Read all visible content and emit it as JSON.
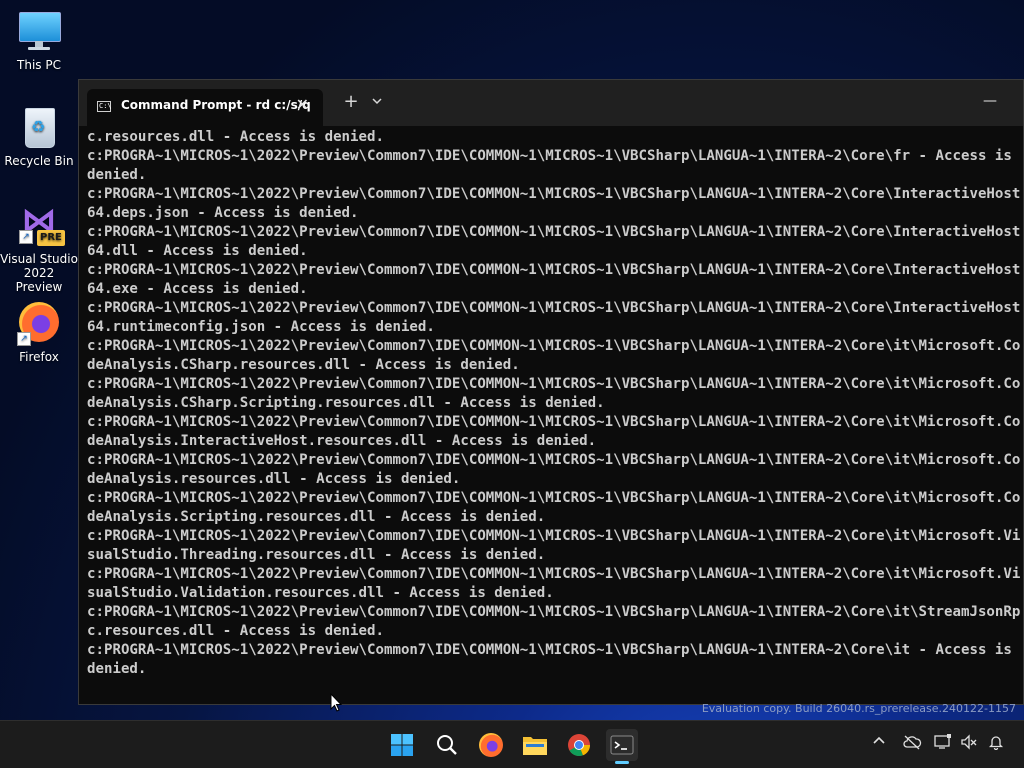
{
  "desktop": {
    "icons": [
      {
        "label": "This PC"
      },
      {
        "label": "Recycle Bin"
      },
      {
        "label_line1": "Visual Studio",
        "label_line2": "2022 Preview",
        "badge": "PRE"
      },
      {
        "label": "Firefox"
      }
    ]
  },
  "terminal": {
    "tab_title": "Command Prompt - rd  c:/s/q",
    "tab_icon_text": "C:\\",
    "close_glyph": "✕",
    "new_tab_glyph": "+",
    "minimize_glyph": "—",
    "lines": [
      "c.resources.dll - Access is denied.",
      "c:PROGRA~1\\MICROS~1\\2022\\Preview\\Common7\\IDE\\COMMON~1\\MICROS~1\\VBCSharp\\LANGUA~1\\INTERA~2\\Core\\fr - Access is",
      "denied.",
      "c:PROGRA~1\\MICROS~1\\2022\\Preview\\Common7\\IDE\\COMMON~1\\MICROS~1\\VBCSharp\\LANGUA~1\\INTERA~2\\Core\\InteractiveHost",
      "64.deps.json - Access is denied.",
      "c:PROGRA~1\\MICROS~1\\2022\\Preview\\Common7\\IDE\\COMMON~1\\MICROS~1\\VBCSharp\\LANGUA~1\\INTERA~2\\Core\\InteractiveHost",
      "64.dll - Access is denied.",
      "c:PROGRA~1\\MICROS~1\\2022\\Preview\\Common7\\IDE\\COMMON~1\\MICROS~1\\VBCSharp\\LANGUA~1\\INTERA~2\\Core\\InteractiveHost",
      "64.exe - Access is denied.",
      "c:PROGRA~1\\MICROS~1\\2022\\Preview\\Common7\\IDE\\COMMON~1\\MICROS~1\\VBCSharp\\LANGUA~1\\INTERA~2\\Core\\InteractiveHost",
      "64.runtimeconfig.json - Access is denied.",
      "c:PROGRA~1\\MICROS~1\\2022\\Preview\\Common7\\IDE\\COMMON~1\\MICROS~1\\VBCSharp\\LANGUA~1\\INTERA~2\\Core\\it\\Microsoft.Co",
      "deAnalysis.CSharp.resources.dll - Access is denied.",
      "c:PROGRA~1\\MICROS~1\\2022\\Preview\\Common7\\IDE\\COMMON~1\\MICROS~1\\VBCSharp\\LANGUA~1\\INTERA~2\\Core\\it\\Microsoft.Co",
      "deAnalysis.CSharp.Scripting.resources.dll - Access is denied.",
      "c:PROGRA~1\\MICROS~1\\2022\\Preview\\Common7\\IDE\\COMMON~1\\MICROS~1\\VBCSharp\\LANGUA~1\\INTERA~2\\Core\\it\\Microsoft.Co",
      "deAnalysis.InteractiveHost.resources.dll - Access is denied.",
      "c:PROGRA~1\\MICROS~1\\2022\\Preview\\Common7\\IDE\\COMMON~1\\MICROS~1\\VBCSharp\\LANGUA~1\\INTERA~2\\Core\\it\\Microsoft.Co",
      "deAnalysis.resources.dll - Access is denied.",
      "c:PROGRA~1\\MICROS~1\\2022\\Preview\\Common7\\IDE\\COMMON~1\\MICROS~1\\VBCSharp\\LANGUA~1\\INTERA~2\\Core\\it\\Microsoft.Co",
      "deAnalysis.Scripting.resources.dll - Access is denied.",
      "c:PROGRA~1\\MICROS~1\\2022\\Preview\\Common7\\IDE\\COMMON~1\\MICROS~1\\VBCSharp\\LANGUA~1\\INTERA~2\\Core\\it\\Microsoft.Vi",
      "sualStudio.Threading.resources.dll - Access is denied.",
      "c:PROGRA~1\\MICROS~1\\2022\\Preview\\Common7\\IDE\\COMMON~1\\MICROS~1\\VBCSharp\\LANGUA~1\\INTERA~2\\Core\\it\\Microsoft.Vi",
      "sualStudio.Validation.resources.dll - Access is denied.",
      "c:PROGRA~1\\MICROS~1\\2022\\Preview\\Common7\\IDE\\COMMON~1\\MICROS~1\\VBCSharp\\LANGUA~1\\INTERA~2\\Core\\it\\StreamJsonRp",
      "c.resources.dll - Access is denied.",
      "c:PROGRA~1\\MICROS~1\\2022\\Preview\\Common7\\IDE\\COMMON~1\\MICROS~1\\VBCSharp\\LANGUA~1\\INTERA~2\\Core\\it - Access is",
      "denied."
    ]
  },
  "watermark": "Evaluation copy. Build 26040.rs_prerelease.240122-1157",
  "taskbar": {
    "apps": [
      "start-icon",
      "search-icon",
      "firefox-icon",
      "file-explorer-icon",
      "chrome-icon",
      "terminal-icon"
    ],
    "tray": [
      "chevron-up-icon",
      "cloud-offline-icon",
      "network-icon",
      "volume-muted-icon",
      "notification-bell-icon"
    ]
  },
  "colors": {
    "console_bg": "#0c0c0c",
    "console_text": "#cccccc",
    "titlebar_bg": "#202020",
    "taskbar_bg": "#1c1c1c",
    "accent": "#60cdff"
  }
}
